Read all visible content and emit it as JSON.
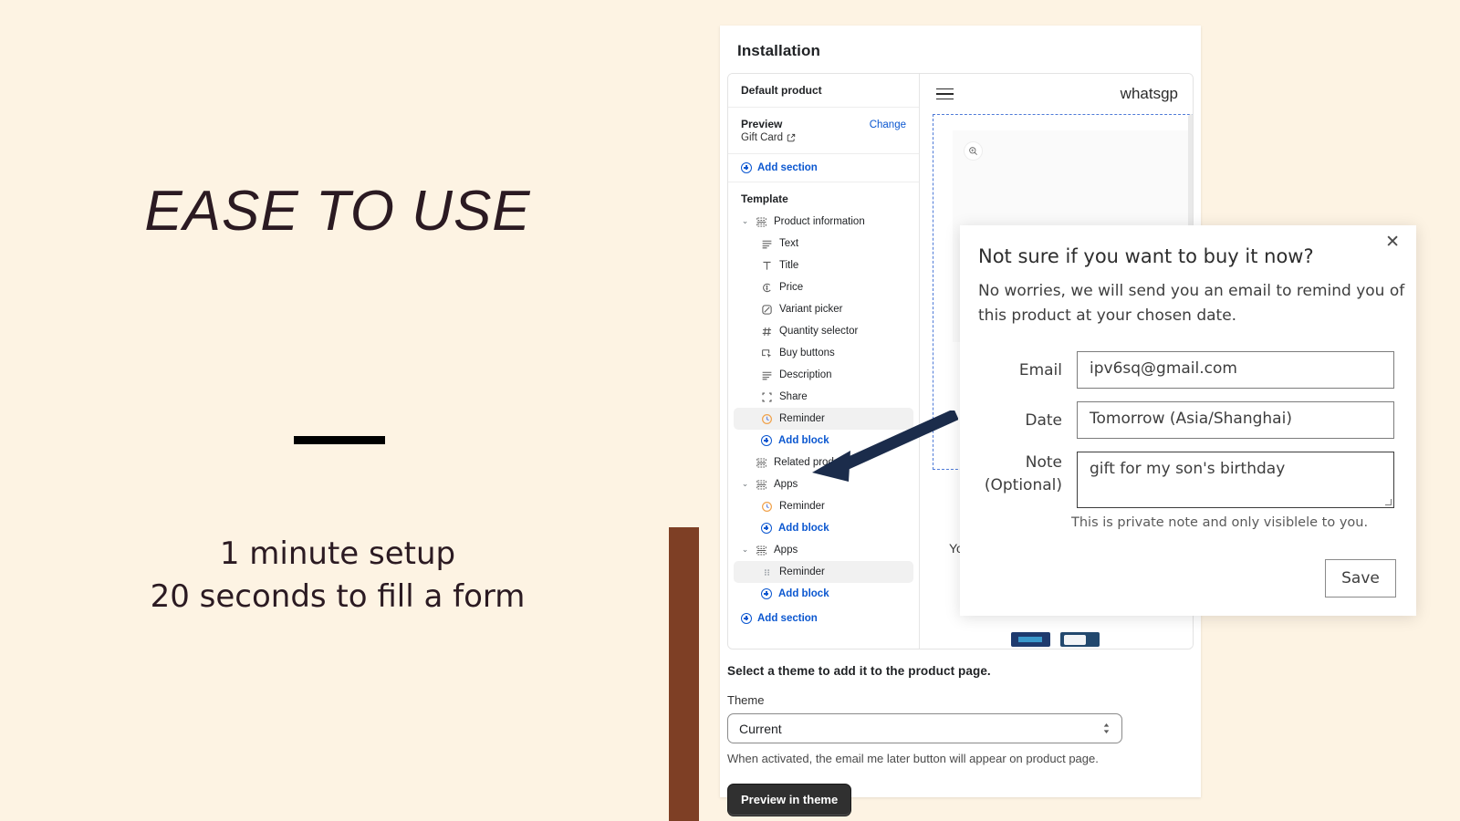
{
  "promo": {
    "headline": "EASE TO USE",
    "sub_line_1": "1 minute setup",
    "sub_line_2": "20 seconds to fill a form"
  },
  "colors": {
    "page_background": "#FDF3E3",
    "accent_bar": "#7E3F25",
    "link_blue": "#0B57D0",
    "arrow": "#1B2C4B",
    "primary_button": "#303030"
  },
  "admin": {
    "title": "Installation",
    "sidebar": {
      "default_product_label": "Default product",
      "preview_label": "Preview",
      "preview_value": "Gift Card",
      "change_link": "Change",
      "add_section_top": "Add section",
      "template_label": "Template",
      "tree": [
        {
          "label": "Product information",
          "icon": "section-icon",
          "level": "section",
          "chevron": "down",
          "selected": false
        },
        {
          "label": "Text",
          "icon": "text-icon",
          "level": "child",
          "chevron": "none",
          "selected": false
        },
        {
          "label": "Title",
          "icon": "title-icon",
          "level": "child",
          "chevron": "none",
          "selected": false
        },
        {
          "label": "Price",
          "icon": "price-icon",
          "level": "child",
          "chevron": "none",
          "selected": false
        },
        {
          "label": "Variant picker",
          "icon": "variant-picker-icon",
          "level": "child",
          "chevron": "none",
          "selected": false
        },
        {
          "label": "Quantity selector",
          "icon": "hash-icon",
          "level": "child",
          "chevron": "none",
          "selected": false
        },
        {
          "label": "Buy buttons",
          "icon": "buy-button-icon",
          "level": "child",
          "chevron": "none",
          "selected": false
        },
        {
          "label": "Description",
          "icon": "description-icon",
          "level": "child",
          "chevron": "none",
          "selected": false
        },
        {
          "label": "Share",
          "icon": "share-icon",
          "level": "child",
          "chevron": "none",
          "selected": false
        },
        {
          "label": "Reminder",
          "icon": "reminder-app-icon",
          "level": "child",
          "chevron": "none",
          "selected": true
        },
        {
          "label": "Add block",
          "icon": "plus-circle-icon",
          "level": "addblock",
          "chevron": "none",
          "selected": false
        },
        {
          "label": "Related products",
          "icon": "section-icon",
          "level": "section",
          "chevron": "none",
          "selected": false
        },
        {
          "label": "Apps",
          "icon": "section-icon",
          "level": "section",
          "chevron": "down",
          "selected": false
        },
        {
          "label": "Reminder",
          "icon": "reminder-app-icon",
          "level": "child",
          "chevron": "none",
          "selected": false
        },
        {
          "label": "Add block",
          "icon": "plus-circle-icon",
          "level": "addblock",
          "chevron": "none",
          "selected": false
        },
        {
          "label": "Apps",
          "icon": "section-icon",
          "level": "section",
          "chevron": "down",
          "selected": false
        },
        {
          "label": "Reminder",
          "icon": "drag-handle-icon",
          "level": "child",
          "chevron": "none",
          "selected": true
        },
        {
          "label": "Add block",
          "icon": "plus-circle-icon",
          "level": "addblock",
          "chevron": "none",
          "selected": false
        }
      ],
      "add_section_bottom": "Add section"
    },
    "store_preview": {
      "brand": "whatsgp",
      "menu_icon": "hamburger-icon",
      "zoom_icon": "zoom-in-icon",
      "product_image": "gift-box-image",
      "partial_text": "Yo"
    },
    "theme": {
      "heading": "Select a theme to add it to the product page.",
      "label": "Theme",
      "selected": "Current",
      "help": "When activated, the email me later button will appear on product page.",
      "preview_button": "Preview in theme"
    }
  },
  "reminder_modal": {
    "close_icon": "close-icon",
    "title": "Not sure if you want to buy it now?",
    "description": "No worries, we will send you an email to remind you of this product at your chosen date.",
    "fields": {
      "email_label": "Email",
      "email_value": "ipv6sq@gmail.com",
      "date_label": "Date",
      "date_value": "Tomorrow  (Asia/Shanghai)",
      "note_label_line1": "Note",
      "note_label_line2": "(Optional)",
      "note_value": "gift for my son's birthday",
      "note_help": "This is private note and only visiblele to you."
    },
    "save_button": "Save"
  }
}
